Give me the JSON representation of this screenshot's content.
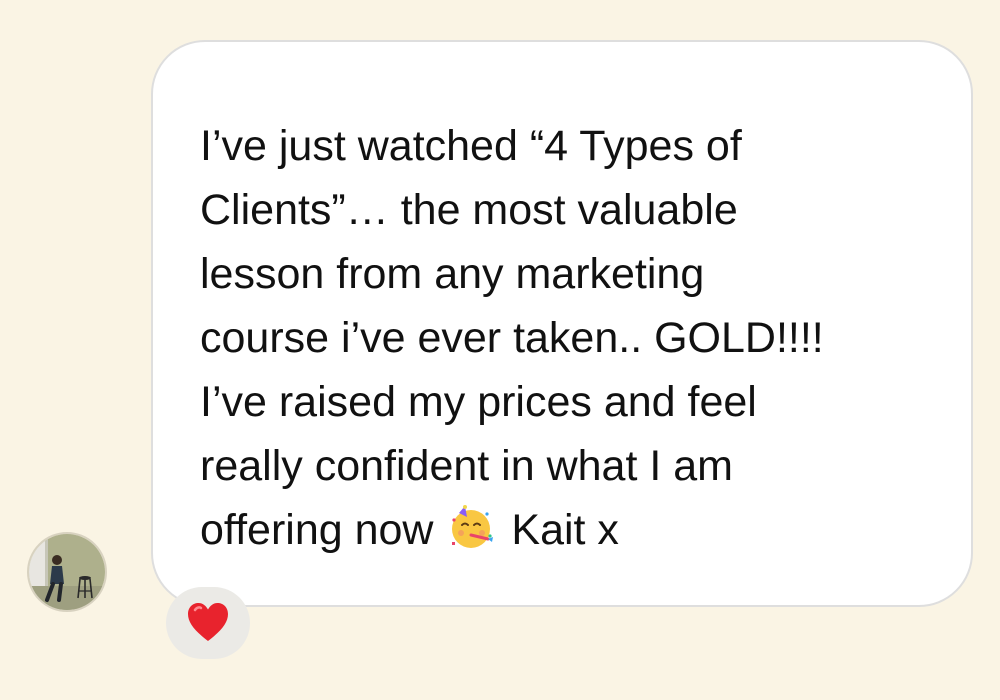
{
  "message": {
    "text_before_emoji": "I’ve just watched “4 Types of\nClients”… the most valuable\nlesson from any marketing\ncourse i’ve ever taken.. GOLD!!!!\nI’ve raised my prices and feel\nreally confident in what I am\noffering now ",
    "emoji_icon": "partying-face-icon",
    "text_after_emoji": " Kait x"
  },
  "avatar": {
    "icon": "profile-photo"
  },
  "reaction": {
    "icon": "red-heart-icon",
    "color": "#e8232d"
  },
  "colors": {
    "background": "#faf4e4",
    "bubble": "#ffffff",
    "bubble_border": "#dedede",
    "reaction_pill": "#ebeae6"
  }
}
